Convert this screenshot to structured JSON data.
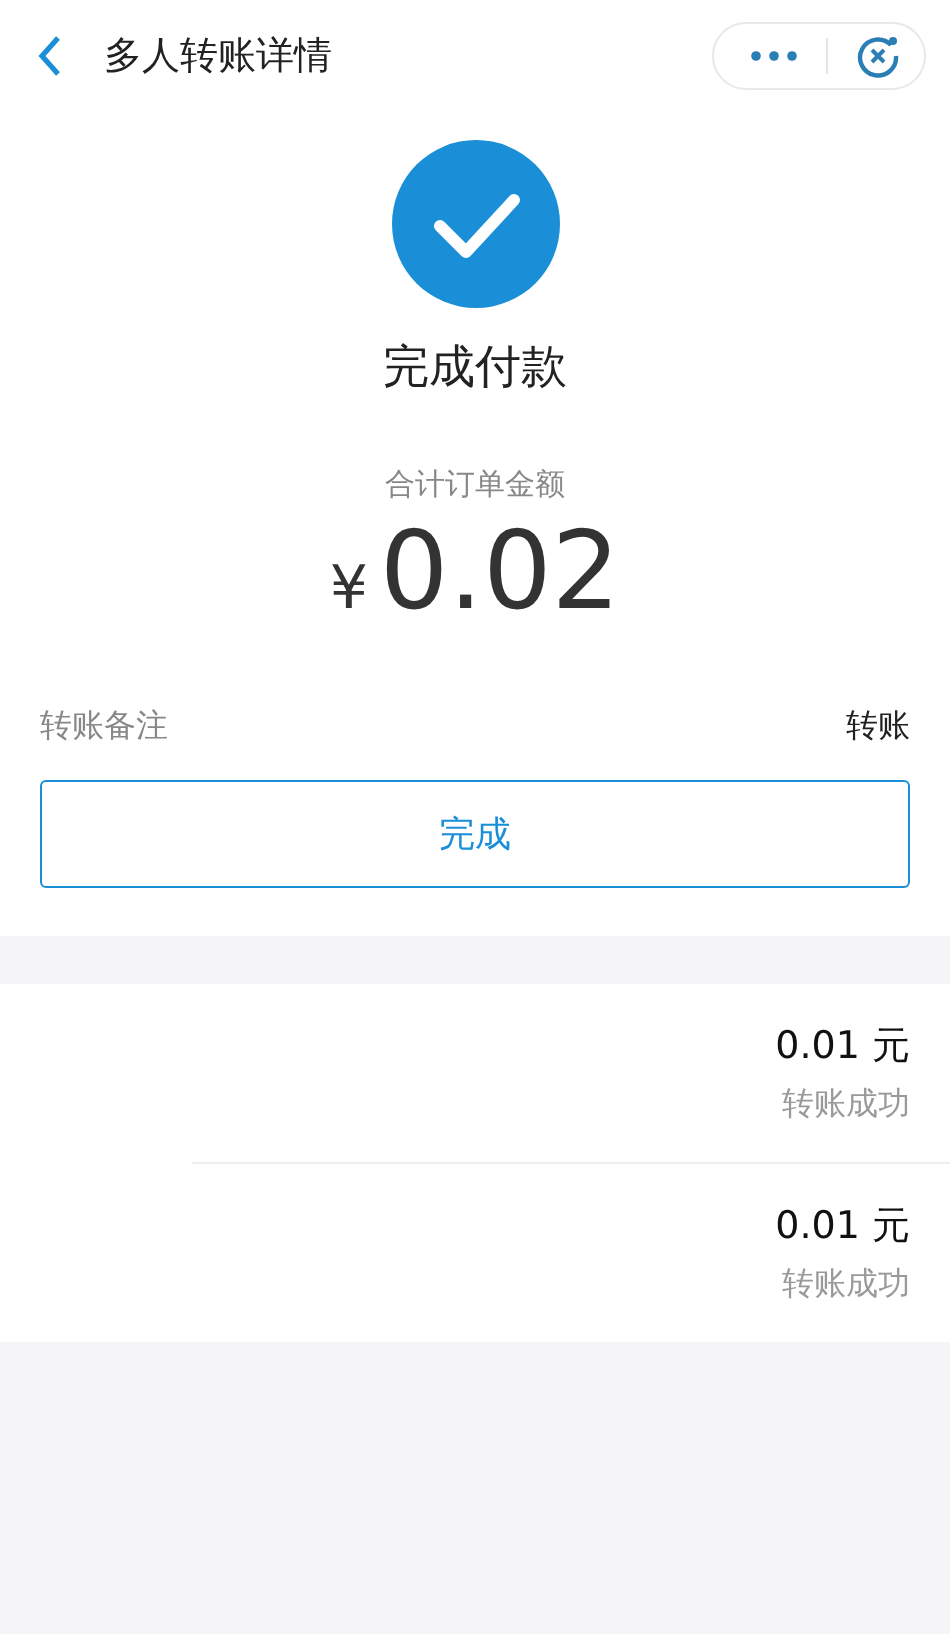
{
  "header": {
    "title": "多人转账详情"
  },
  "result": {
    "title": "完成付款",
    "amount_label": "合计订单金额",
    "currency": "¥",
    "amount": "0.02"
  },
  "remark": {
    "label": "转账备注",
    "value": "转账"
  },
  "done_button": "完成",
  "transfers": [
    {
      "amount": "0.01 元",
      "status": "转账成功"
    },
    {
      "amount": "0.01 元",
      "status": "转账成功"
    }
  ]
}
